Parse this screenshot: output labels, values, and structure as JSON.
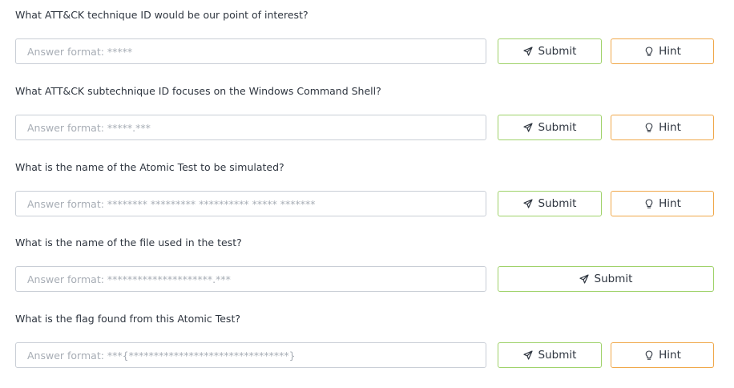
{
  "questions": [
    {
      "question": "What ATT&CK technique ID would be our point of interest?",
      "placeholder": "Answer format: *****",
      "value": "",
      "submit_label": "Submit",
      "hint_label": "Hint",
      "has_hint": true
    },
    {
      "question": "What ATT&CK subtechnique ID focuses on the Windows Command Shell?",
      "placeholder": "Answer format: *****.***",
      "value": "",
      "submit_label": "Submit",
      "hint_label": "Hint",
      "has_hint": true
    },
    {
      "question": "What is the name of the Atomic Test to be simulated?",
      "placeholder": "Answer format: ******** ********* ********** ***** *******",
      "value": "",
      "submit_label": "Submit",
      "hint_label": "Hint",
      "has_hint": true
    },
    {
      "question": "What is the name of the file used in the test?",
      "placeholder": "Answer format: *********************.***",
      "value": "",
      "submit_label": "Submit",
      "has_hint": false
    },
    {
      "question": "What is the flag found from this Atomic Test?",
      "placeholder": "Answer format: ***{********************************}",
      "value": "",
      "submit_label": "Submit",
      "hint_label": "Hint",
      "has_hint": true
    }
  ],
  "icons": {
    "submit": "paper-plane-icon",
    "hint": "lightbulb-icon"
  },
  "colors": {
    "submit_border": "#9fd26a",
    "hint_border": "#f0a84a",
    "input_border": "#c9ced6",
    "placeholder": "#a7adb5",
    "text": "#2f3640"
  }
}
